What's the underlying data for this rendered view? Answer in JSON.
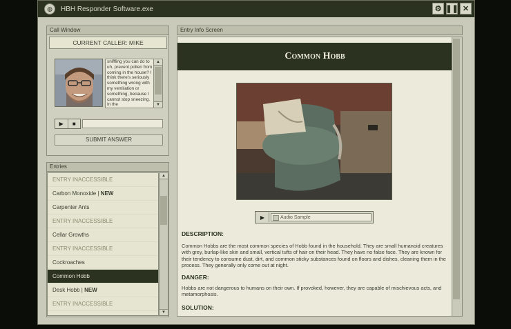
{
  "window": {
    "title": "HBH Responder Software.exe"
  },
  "call_window": {
    "header": "Call Window",
    "caller_label": "CURRENT CALLER: MIKE",
    "transcript": "sniffling you can do to uh, prevent pollen from coming in the house? I think there's seriously something wrong with my ventilation or something, because I cannot stop sneezing. In the",
    "submit_label": "SUBMIT ANSWER",
    "play_icon": "▶",
    "stop_icon": "■"
  },
  "entries": {
    "header": "Entries",
    "items": [
      {
        "label": "ENTRY INACCESSIBLE",
        "new": "",
        "state": "inacc"
      },
      {
        "label": "Carbon Monoxide",
        "new": "NEW",
        "state": "normal"
      },
      {
        "label": "Carpenter Ants",
        "new": "",
        "state": "normal"
      },
      {
        "label": "ENTRY INACCESSIBLE",
        "new": "",
        "state": "inacc"
      },
      {
        "label": "Cellar Growths",
        "new": "",
        "state": "normal"
      },
      {
        "label": "ENTRY INACCESSIBLE",
        "new": "",
        "state": "inacc"
      },
      {
        "label": "Cockroaches",
        "new": "",
        "state": "normal"
      },
      {
        "label": "Common Hobb",
        "new": "",
        "state": "selected"
      },
      {
        "label": "Desk Hobb",
        "new": "NEW",
        "state": "normal"
      },
      {
        "label": "ENTRY INACCESSIBLE",
        "new": "",
        "state": "inacc"
      },
      {
        "label": "ENTRY INACCESSIBLE",
        "new": "",
        "state": "inacc"
      }
    ]
  },
  "info": {
    "header": "Entry Info Screen",
    "title": "Common Hobb",
    "audio_label": "Audio Sample",
    "description_head": "DESCRIPTION:",
    "description": "Common Hobbs are the most common species of Hobb found in the household. They are small humanoid creatures with grey, burlap-like skin and small, vertical tufts of hair on their head. They have no false face. They are known for their tendency to consume dust, dirt, and common sticky substances found on floors and dishes, cleaning them in the process. They generally only come out at night.",
    "danger_head": "DANGER:",
    "danger": "Hobbs are not dangerous to humans on their own. If provoked, however, they are capable of mischievous acts, and metamorphosis.",
    "solution_head": "SOLUTION:"
  },
  "colors": {
    "titlebar": "#2b321f",
    "panel": "#c9cab9",
    "selected": "#2b321f"
  },
  "icons": {
    "app": "globe-icon",
    "window_buttons": [
      "gear-icon",
      "pause-icon",
      "close-icon"
    ]
  }
}
